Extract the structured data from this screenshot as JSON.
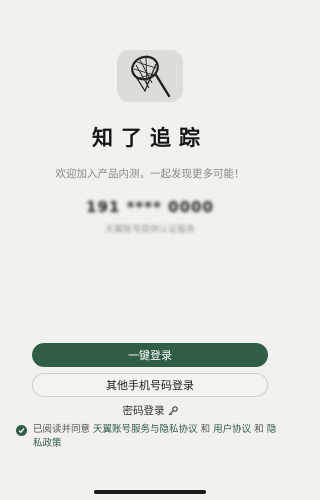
{
  "app": {
    "logo_icon": "butterfly-net-icon",
    "name": "知了追踪",
    "slogan": "欢迎加入产品内测，一起发现更多可能！"
  },
  "phone": {
    "masked_number": "191 **** 0000",
    "carrier_note": "天翼账号提供认证服务"
  },
  "buttons": {
    "one_click_login": "一键登录",
    "other_phone_login": "其他手机号码登录"
  },
  "password_login": {
    "label": "密码登录",
    "icon": "key-icon"
  },
  "agreement": {
    "checked": true,
    "prefix": "已阅读并同意",
    "link1": "天翼账号服务与隐私协议",
    "sep1": "和",
    "link2": "用户协议",
    "sep2": "和",
    "link3": "隐私政策"
  },
  "colors": {
    "background": "#f2f1ee",
    "primary": "#2f5e45",
    "logo_bg": "#dddcd7"
  }
}
